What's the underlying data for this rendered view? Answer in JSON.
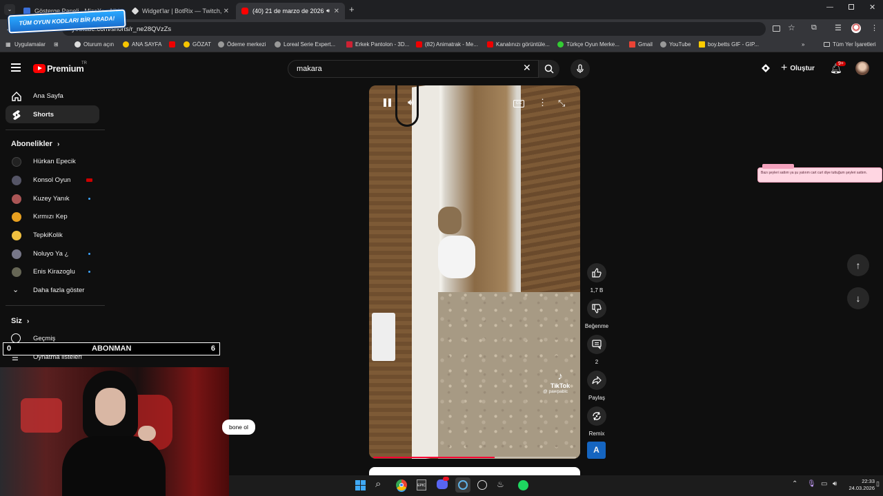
{
  "browser": {
    "tabs": [
      {
        "title": "Gösterge Paneli - MissXss AI B...",
        "active": false
      },
      {
        "title": "Widget'lar | BotRix — Twitch, K...",
        "active": false
      },
      {
        "title": "(40) 21 de marzo de 2026 -",
        "active": true
      }
    ],
    "url": "youtube.com/shorts/r_ne28QVzZs",
    "bookmarks": [
      "Uygulamalar",
      "Oturum açın",
      "ANA SAYFA",
      "GÖZAT",
      "Ödeme merkezi",
      "Loreal Serie Expert...",
      "Erkek Pantolon - 3D...",
      "(82) Animatrak - Me...",
      "Kanalınızı görüntüle...",
      "Türkçe Oyun Merke...",
      "Gmail",
      "YouTube",
      "boy.betts GIF - GIP...",
      "Tüm Yer İşaretleri"
    ]
  },
  "overlay": {
    "game_codes_banner": "TÜM OYUN KODLARI BİR ARADA!",
    "counter_left": "0",
    "counter_label": "ABONMAN",
    "counter_right": "6",
    "chat_snippet": "bone ol",
    "donation_text": "Bazı şeyleri sattım ya şu yatırım cart curt diye tuttuğum şeyleri sattım."
  },
  "header": {
    "logo": "Premium",
    "logo_sup": "TR",
    "search_value": "makara",
    "create_label": "Oluştur",
    "notif_count": "9+"
  },
  "sidebar": {
    "home": "Ana Sayfa",
    "shorts": "Shorts",
    "subscriptions_title": "Abonelikler",
    "channels": [
      "Hürkan Epecik",
      "Konsol Oyun",
      "Kuzey Yanık",
      "Kırmızı Kep",
      "TepkiKolik",
      "Noluyo Ya ¿",
      "Enis Kirazoglu"
    ],
    "show_more": "Daha fazla göster",
    "you_title": "Siz",
    "history": "Geçmiş",
    "playlists": "Oynatma listeleri"
  },
  "video": {
    "watermark": "TikTok",
    "watermark_handle": "@ pawpablc",
    "cc": "CC",
    "progress": 0.6
  },
  "actions": {
    "likes": "1,7 B",
    "dislike": "Beğenme",
    "comments": "2",
    "share": "Paylaş",
    "remix": "Remix",
    "channel_letter": "A"
  },
  "tray": {
    "time": "22:33",
    "date": "24.03.2026"
  },
  "colors": {
    "accent_red": "#ff0000",
    "bg": "#0f0f0f",
    "link_blue": "#3ea6ff"
  }
}
